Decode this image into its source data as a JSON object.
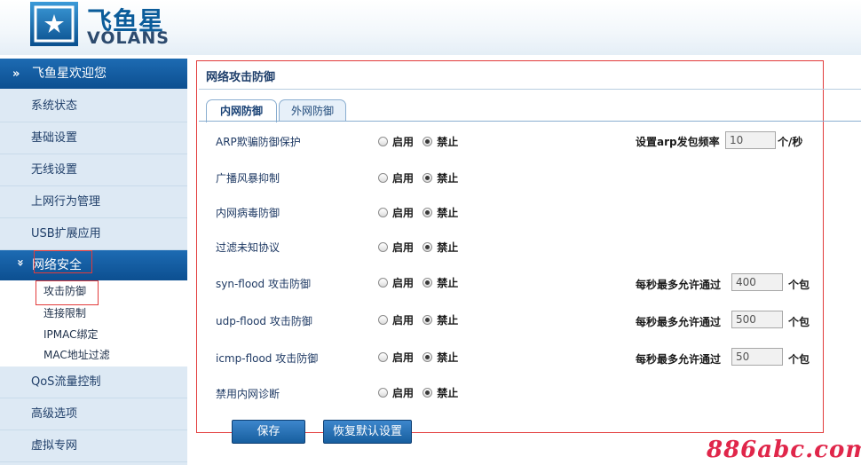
{
  "logo": {
    "cn": "飞鱼星",
    "en": "VOLANS"
  },
  "sidebar": {
    "welcome": "飞鱼星欢迎您",
    "welcome_arrow": "»",
    "items": [
      {
        "label": "系统状态"
      },
      {
        "label": "基础设置"
      },
      {
        "label": "无线设置"
      },
      {
        "label": "上网行为管理"
      },
      {
        "label": "USB扩展应用"
      }
    ],
    "security": {
      "label": "网络安全",
      "arrow": "»"
    },
    "sub_items": [
      {
        "label": "攻击防御"
      },
      {
        "label": "连接限制"
      },
      {
        "label": "IPMAC绑定"
      },
      {
        "label": "MAC地址过滤"
      }
    ],
    "bottom_items": [
      {
        "label": "QoS流量控制"
      },
      {
        "label": "高级选项"
      },
      {
        "label": "虚拟专网"
      }
    ]
  },
  "panel": {
    "title": "网络攻击防御",
    "tabs": [
      {
        "label": "内网防御",
        "active": true
      },
      {
        "label": "外网防御",
        "active": false
      }
    ],
    "radio_on": "启用",
    "radio_off": "禁止",
    "rows": [
      {
        "label": "ARP欺骗防御保护",
        "value": "禁止",
        "extra": {
          "label": "设置arp发包频率",
          "value": "10",
          "unit": "个/秒"
        }
      },
      {
        "label": "广播风暴抑制",
        "value": "禁止"
      },
      {
        "label": "内网病毒防御",
        "value": "禁止"
      },
      {
        "label": "过滤未知协议",
        "value": "禁止"
      },
      {
        "label": "syn-flood 攻击防御",
        "value": "禁止",
        "extra": {
          "label": "每秒最多允许通过",
          "value": "400",
          "unit": "个包"
        }
      },
      {
        "label": "udp-flood 攻击防御",
        "value": "禁止",
        "extra": {
          "label": "每秒最多允许通过",
          "value": "500",
          "unit": "个包"
        }
      },
      {
        "label": "icmp-flood 攻击防御",
        "value": "禁止",
        "extra": {
          "label": "每秒最多允许通过",
          "value": "50",
          "unit": "个包"
        }
      },
      {
        "label": "禁用内网诊断",
        "value": "禁止"
      }
    ],
    "buttons": {
      "save": "保存",
      "restore": "恢复默认设置"
    }
  },
  "watermark": "886abc.com",
  "colors": {
    "nav_blue": "#0c4f91",
    "highlight_red": "#e23b3b",
    "watermark": "#e0264a"
  }
}
